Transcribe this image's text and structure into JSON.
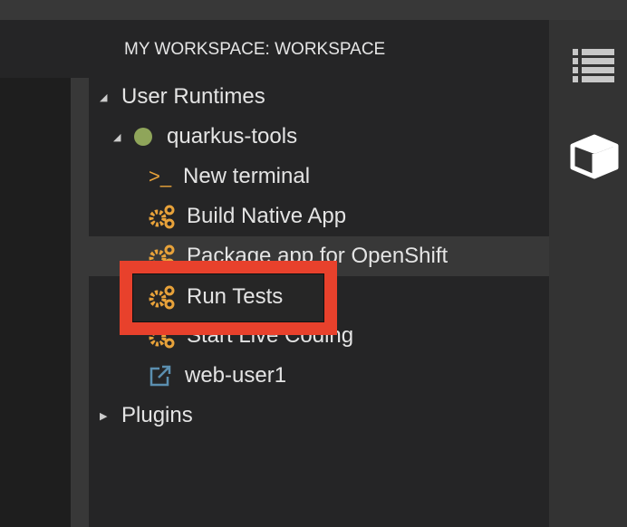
{
  "header": {
    "title": "MY WORKSPACE: WORKSPACE"
  },
  "tree": {
    "user_runtimes": "User Runtimes",
    "machine": {
      "name": "quarkus-tools",
      "status_color": "#8fa55a"
    },
    "items": [
      {
        "label": "New terminal",
        "icon": "terminal-icon"
      },
      {
        "label": "Build Native App",
        "icon": "gears-icon"
      },
      {
        "label": "Package app for OpenShift",
        "icon": "gears-icon"
      },
      {
        "label": "Run Tests",
        "icon": "gears-icon"
      },
      {
        "label": "Start Live Coding",
        "icon": "gears-icon"
      },
      {
        "label": "web-user1",
        "icon": "external-link-icon"
      }
    ],
    "plugins": "Plugins"
  },
  "colors": {
    "accent": "#e8a23a",
    "highlight": "#e8412c",
    "link": "#5b8fb0"
  }
}
